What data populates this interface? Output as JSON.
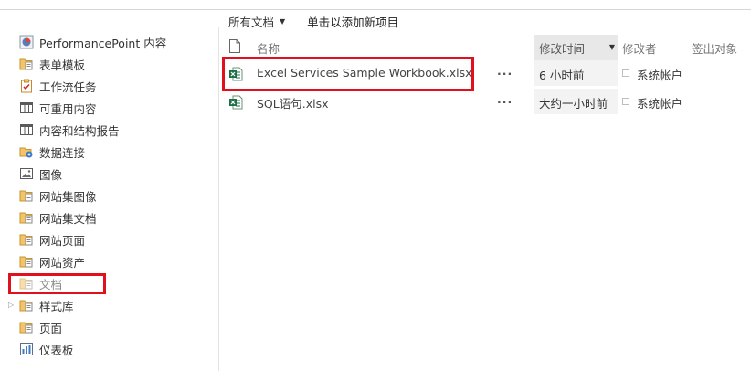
{
  "colors": {
    "highlight": "#e0101c",
    "folder": "#f4c46a",
    "excel": "#1e7145",
    "sort_header_bg": "#e8e8e8"
  },
  "nav": {
    "items": [
      {
        "label": "PerformancePoint 内容",
        "icon": "performancepoint-icon"
      },
      {
        "label": "表单模板",
        "icon": "library-folder-icon"
      },
      {
        "label": "工作流任务",
        "icon": "task-list-icon"
      },
      {
        "label": "可重用内容",
        "icon": "list-table-icon"
      },
      {
        "label": "内容和结构报告",
        "icon": "list-table-icon"
      },
      {
        "label": "数据连接",
        "icon": "data-connection-icon"
      },
      {
        "label": "图像",
        "icon": "image-library-icon"
      },
      {
        "label": "网站集图像",
        "icon": "library-folder-icon"
      },
      {
        "label": "网站集文档",
        "icon": "library-folder-icon"
      },
      {
        "label": "网站页面",
        "icon": "library-folder-icon"
      },
      {
        "label": "网站资产",
        "icon": "library-folder-icon"
      },
      {
        "label": "文档",
        "icon": "library-folder-icon"
      },
      {
        "label": "样式库",
        "icon": "library-folder-icon"
      },
      {
        "label": "页面",
        "icon": "library-folder-icon"
      },
      {
        "label": "仪表板",
        "icon": "dashboard-icon"
      }
    ]
  },
  "toolbar": {
    "view_label": "所有文档",
    "add_item_label": "单击以添加新项目"
  },
  "columns": {
    "name": "名称",
    "modified": "修改时间",
    "modified_by": "修改者",
    "checked_out_to": "签出对象"
  },
  "rows": [
    {
      "name": "Excel Services Sample Workbook.xlsx",
      "modified": "6 小时前",
      "modified_by": "系统帐户",
      "icon": "excel-file-icon"
    },
    {
      "name": "SQL语句.xlsx",
      "modified": "大约一小时前",
      "modified_by": "系统帐户",
      "icon": "excel-file-icon"
    }
  ],
  "row_menu_label": "..."
}
